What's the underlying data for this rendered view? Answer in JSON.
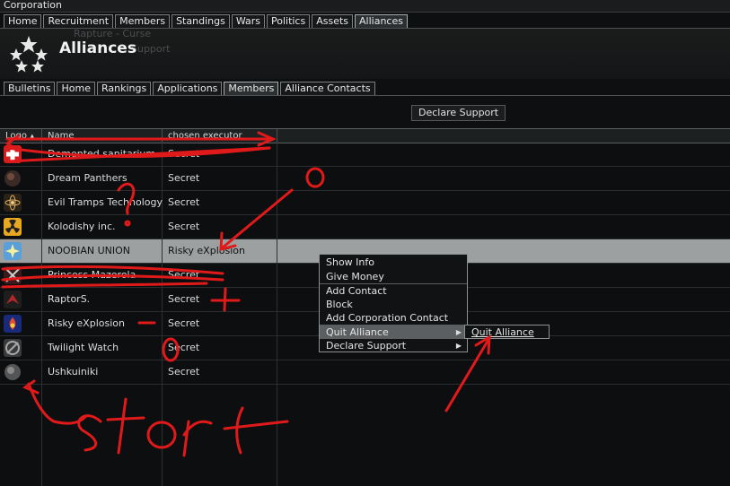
{
  "window": {
    "title": "Corporation"
  },
  "main_tabs": [
    {
      "label": "Home",
      "active": false
    },
    {
      "label": "Recruitment",
      "active": false
    },
    {
      "label": "Members",
      "active": false
    },
    {
      "label": "Standings",
      "active": false
    },
    {
      "label": "Wars",
      "active": false
    },
    {
      "label": "Politics",
      "active": false
    },
    {
      "label": "Assets",
      "active": false
    },
    {
      "label": "Alliances",
      "active": true
    }
  ],
  "header": {
    "title": "Alliances",
    "background_text_1": "Rapture - Curse",
    "background_text_2": "Support"
  },
  "sub_tabs": [
    {
      "label": "Bulletins",
      "active": false
    },
    {
      "label": "Home",
      "active": false
    },
    {
      "label": "Rankings",
      "active": false
    },
    {
      "label": "Applications",
      "active": false
    },
    {
      "label": "Members",
      "active": true
    },
    {
      "label": "Alliance Contacts",
      "active": false
    }
  ],
  "declare_support_button": "Declare Support",
  "table": {
    "columns": [
      "Logo",
      "Name",
      "chosen executor"
    ],
    "rows": [
      {
        "name": "Demented sanitarium",
        "executor": "Secret",
        "icon": "red-cross-icon",
        "selected": false
      },
      {
        "name": "Dream Panthers",
        "executor": "Secret",
        "icon": "dark-circle-icon",
        "selected": false
      },
      {
        "name": "Evil Tramps Technology",
        "executor": "Secret",
        "icon": "atom-icon",
        "selected": false
      },
      {
        "name": "Kolodishy inc.",
        "executor": "Secret",
        "icon": "radiation-icon",
        "selected": false
      },
      {
        "name": "NOOBIAN UNION",
        "executor": "Risky eXplosion",
        "icon": "star-burst-icon",
        "selected": true
      },
      {
        "name": "Princess Mazerola",
        "executor": "Secret",
        "icon": "swords-icon",
        "selected": false
      },
      {
        "name": "RaptorS.",
        "executor": "Secret",
        "icon": "raptor-icon",
        "selected": false
      },
      {
        "name": "Risky eXplosion",
        "executor": "Secret",
        "icon": "blue-flame-icon",
        "selected": false
      },
      {
        "name": "Twilight Watch",
        "executor": "Secret",
        "icon": "emblem-icon",
        "selected": false
      },
      {
        "name": "Ushkuiniki",
        "executor": "Secret",
        "icon": "grey-orb-icon",
        "selected": false
      }
    ]
  },
  "context_menu": {
    "items": [
      "Show Info",
      "Give Money",
      "Add Contact",
      "Block",
      "Add Corporation Contact",
      "Quit Alliance",
      "Declare Support"
    ],
    "highlighted": "Quit Alliance"
  },
  "submenu": {
    "items": [
      "Quit Alliance"
    ]
  },
  "annotations": {
    "question": "?",
    "marks": [
      "o",
      "+",
      "-",
      "o"
    ],
    "scrawl": "start"
  },
  "colors": {
    "selected_row": "#9da0a1",
    "annotation_red": "#e01a1a",
    "background": "#0d0f10"
  }
}
